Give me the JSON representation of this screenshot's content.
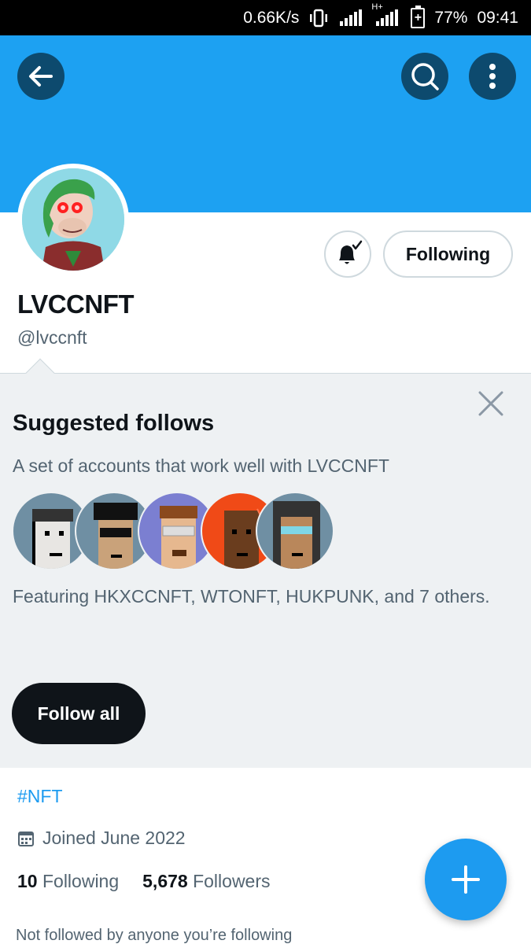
{
  "status_bar": {
    "speed": "0.66K/s",
    "network": "H+",
    "battery_percent": "77%",
    "time": "09:41"
  },
  "header": {
    "back_icon": "arrow-left-icon",
    "search_icon": "search-icon",
    "more_icon": "more-vertical-icon",
    "banner_color": "#1da1f2"
  },
  "profile": {
    "display_name": "LVCCNFT",
    "handle": "@lvccnft",
    "following_button": "Following",
    "notification_icon": "bell-subscribed-icon",
    "hashtag": "#NFT",
    "joined": "Joined June 2022",
    "following_count": "10",
    "following_label": "Following",
    "followers_count": "5,678",
    "followers_label": "Followers",
    "not_followed": "Not followed by anyone you’re following"
  },
  "suggested": {
    "title": "Suggested follows",
    "subtitle": "A set of accounts that work well with LVCCNFT",
    "featuring": "Featuring HKXCCNFT, WTONFT, HUKPUNK, and 7 others.",
    "follow_all": "Follow all",
    "avatar_colors": [
      "#6f8fa3",
      "#6f8fa3",
      "#7b7fd1",
      "#f04a17",
      "#6f8fa3"
    ]
  },
  "fab": {
    "icon": "plus-icon",
    "accent": "#1d9bf0"
  }
}
